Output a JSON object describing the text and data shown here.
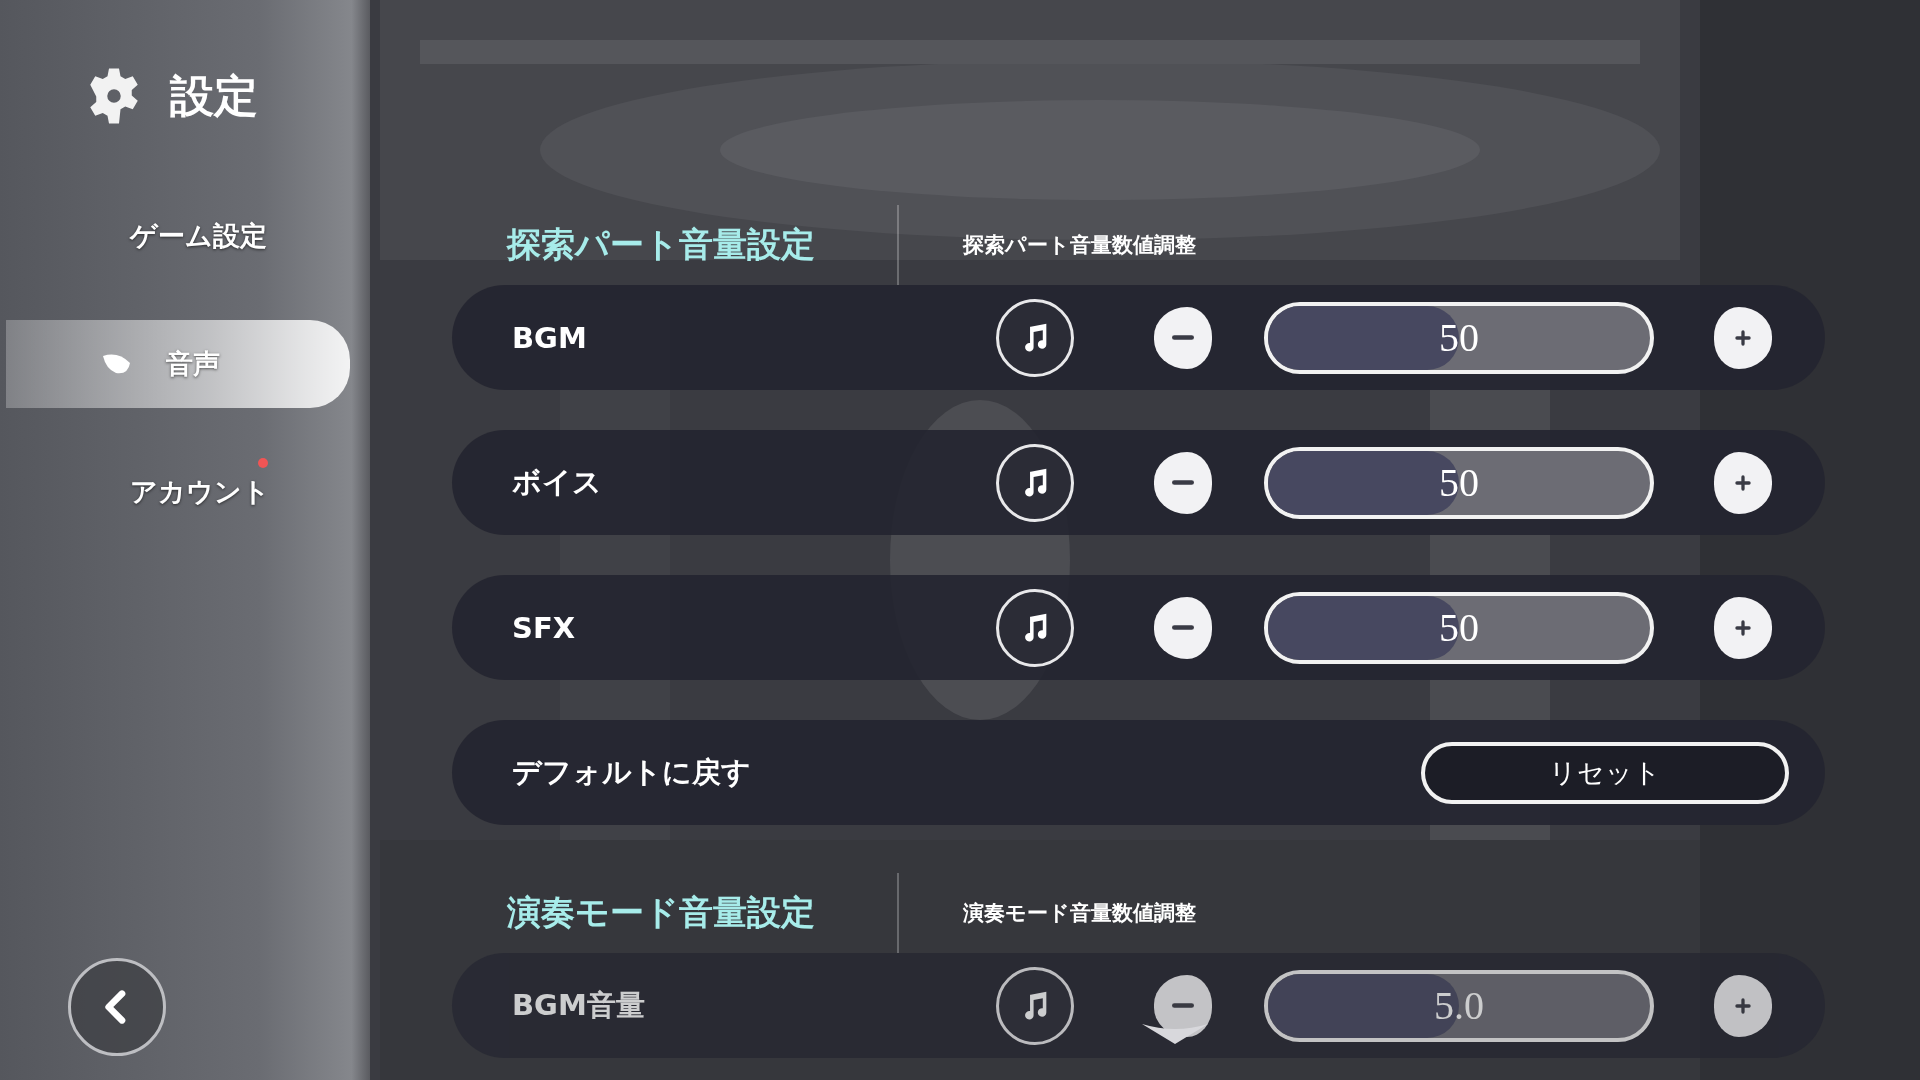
{
  "sidebar": {
    "title": "設定",
    "items": [
      {
        "label": "ゲーム設定",
        "selected": false,
        "badge": false
      },
      {
        "label": "音声",
        "selected": true,
        "badge": false
      },
      {
        "label": "アカウント",
        "selected": false,
        "badge": true
      }
    ]
  },
  "sections": [
    {
      "title": "探索パート音量設定",
      "subtitle": "探索パート音量数値調整",
      "rows": [
        {
          "kind": "volume",
          "label": "BGM",
          "value": "50",
          "level": 0.5
        },
        {
          "kind": "volume",
          "label": "ボイス",
          "value": "50",
          "level": 0.5
        },
        {
          "kind": "volume",
          "label": "SFX",
          "value": "50",
          "level": 0.5
        },
        {
          "kind": "reset",
          "label": "デフォルトに戻す",
          "button": "リセット"
        }
      ]
    },
    {
      "title": "演奏モード音量設定",
      "subtitle": "演奏モード音量数値調整",
      "rows": [
        {
          "kind": "volume",
          "label": "BGM音量",
          "value": "5.0",
          "level": 0.5
        }
      ]
    }
  ]
}
